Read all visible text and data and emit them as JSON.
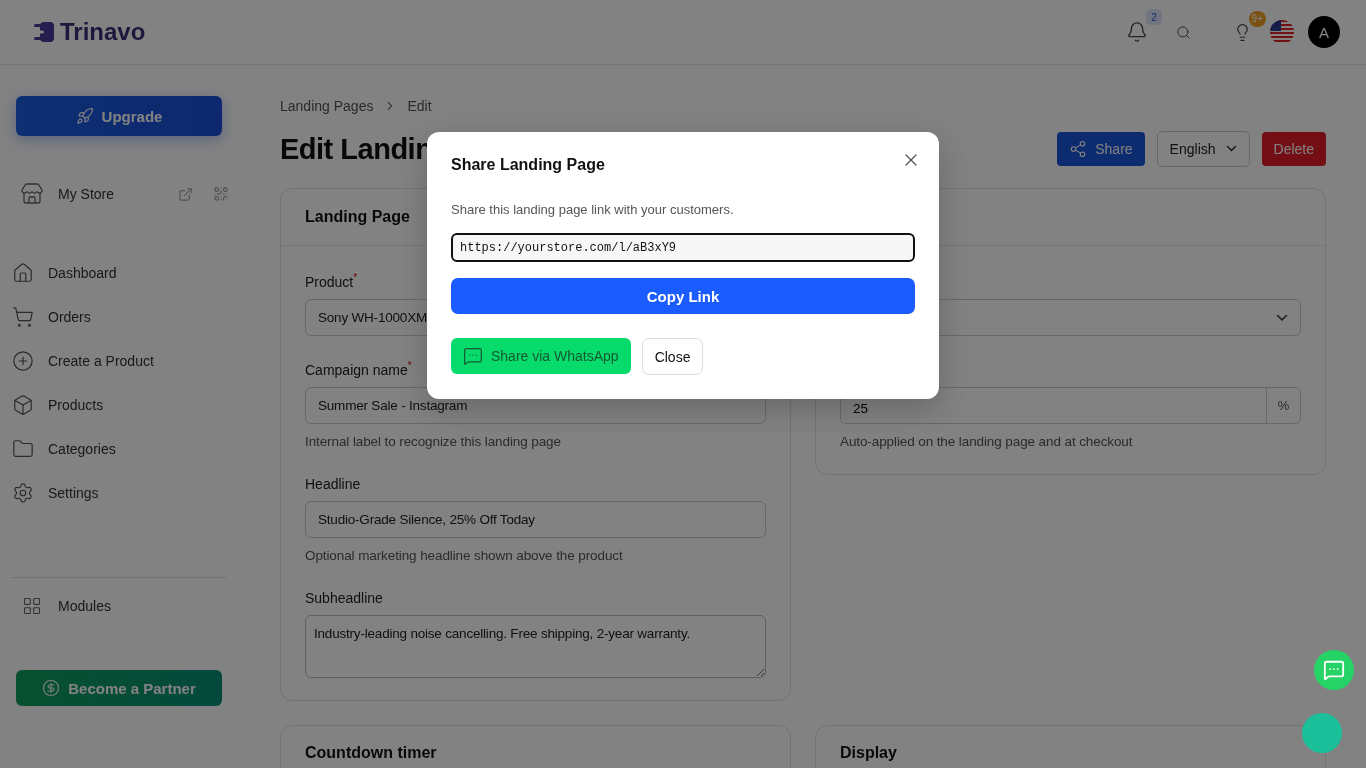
{
  "header": {
    "logo": "Trinavo",
    "notifications_badge": "2",
    "tips_badge": "9+",
    "avatar": "A"
  },
  "sidebar": {
    "upgrade": "Upgrade",
    "store": "My Store",
    "items": [
      {
        "label": "Dashboard"
      },
      {
        "label": "Orders"
      },
      {
        "label": "Create a Product"
      },
      {
        "label": "Products"
      },
      {
        "label": "Categories"
      },
      {
        "label": "Settings"
      }
    ],
    "modules": "Modules",
    "partner": "Become a Partner"
  },
  "breadcrumb": [
    "Landing Pages",
    "Edit"
  ],
  "page_title": "Edit Landin",
  "actions": {
    "share": "Share",
    "language": "English",
    "delete": "Delete"
  },
  "landing_card": {
    "title": "Landing Page",
    "fields": [
      {
        "kind": "select",
        "label": "Product",
        "marker": "*",
        "value": "Sony WH-1000XM"
      },
      {
        "kind": "input",
        "label": "Campaign name",
        "marker": "*",
        "value": "Summer Sale - Instagram",
        "help": "Internal label to recognize this landing page"
      },
      {
        "kind": "input",
        "label": "Headline",
        "value": "Studio-Grade Silence, 25% Off Today",
        "help": "Optional marketing headline shown above the product"
      },
      {
        "kind": "textarea",
        "label": "Subheadline",
        "value": "Industry-leading noise cancelling. Free shipping, 2-year warranty."
      }
    ]
  },
  "discount_card": {
    "value": "25",
    "suffix": "%",
    "help": "Auto-applied on the landing page and at checkout"
  },
  "bottom_cards": [
    "Countdown timer",
    "Display"
  ],
  "modal": {
    "title": "Share Landing Page",
    "description": "Share this landing page link with your customers.",
    "link": "https://yourstore.com/l/aB3xY9",
    "copy": "Copy Link",
    "whatsapp": "Share via WhatsApp",
    "close": "Close"
  }
}
